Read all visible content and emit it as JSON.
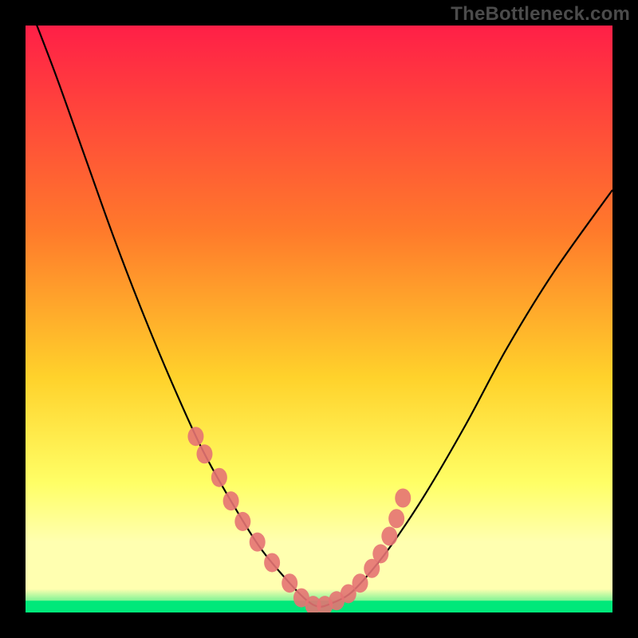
{
  "watermark": "TheBottleneck.com",
  "colors": {
    "bg": "#000000",
    "grad_top": "#ff1f47",
    "grad_mid1": "#ff7a2b",
    "grad_mid2": "#ffd22b",
    "grad_mid3": "#ffff66",
    "grad_mid4": "#ffffb0",
    "grad_bottom": "#00e87a",
    "curve": "#000000",
    "marker_fill": "#e57373",
    "marker_stroke": "#c05050"
  },
  "chart_data": {
    "type": "line",
    "title": "",
    "xlabel": "",
    "ylabel": "",
    "xlim": [
      0,
      100
    ],
    "ylim": [
      0,
      100
    ],
    "series": [
      {
        "name": "bottleneck-curve",
        "x": [
          0,
          5,
          10,
          15,
          20,
          25,
          30,
          35,
          40,
          45,
          48,
          50,
          52,
          55,
          58,
          62,
          68,
          75,
          82,
          90,
          100
        ],
        "y": [
          105,
          92,
          78,
          64,
          51,
          39,
          28,
          19,
          11,
          5,
          2,
          1,
          1.5,
          3,
          6,
          11,
          20,
          32,
          45,
          58,
          72
        ]
      }
    ],
    "markers": {
      "name": "highlight-points",
      "x": [
        29,
        30.5,
        33,
        35,
        37,
        39.5,
        42,
        45,
        47,
        49,
        51,
        53,
        55,
        57,
        59,
        60.5,
        62,
        63.2,
        64.3
      ],
      "y": [
        30,
        27,
        23,
        19,
        15.5,
        12,
        8.5,
        5,
        2.5,
        1.2,
        1.2,
        2,
        3.2,
        5,
        7.5,
        10,
        13,
        16,
        19.5
      ]
    },
    "gradient_bands": [
      {
        "from_y": 100,
        "to_y": 20,
        "type": "smooth"
      },
      {
        "from_y": 20,
        "to_y": 10,
        "type": "smooth"
      },
      {
        "from_y": 10,
        "to_y": 2,
        "type": "smooth"
      },
      {
        "from_y": 2,
        "to_y": 0,
        "type": "solid_green"
      }
    ]
  }
}
